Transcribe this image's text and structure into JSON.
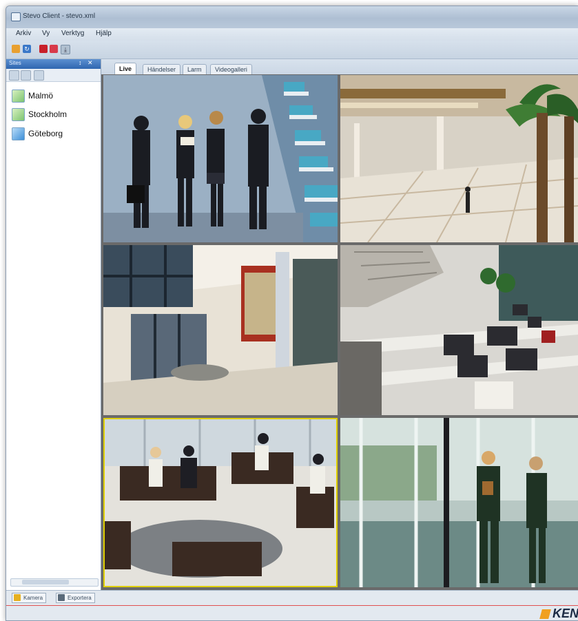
{
  "window": {
    "title": "Stevo Client - stevo.xml"
  },
  "menu": [
    "Arkiv",
    "Vy",
    "Verktyg",
    "Hjälp"
  ],
  "sidebar": {
    "title": "Sites",
    "pin": "↕",
    "close": "✕",
    "sites": [
      {
        "label": "Malmö"
      },
      {
        "label": "Stockholm"
      },
      {
        "label": "Göteborg"
      }
    ]
  },
  "tabs": [
    {
      "label": "Live",
      "active": true
    },
    {
      "label": "Händelser",
      "active": false
    },
    {
      "label": "Larm",
      "active": false
    },
    {
      "label": "Videogalleri",
      "active": false
    }
  ],
  "bottom_tabs": [
    "Kamera",
    "Exportera"
  ],
  "logo": {
    "text": "KEN"
  },
  "cameras": [
    {
      "scene": "businesspeople-stairs",
      "selected": false
    },
    {
      "scene": "mall-atrium-palms",
      "selected": false
    },
    {
      "scene": "office-lobby-entrance",
      "selected": false
    },
    {
      "scene": "stairs-lobby-seating",
      "selected": false
    },
    {
      "scene": "lounge-sofas-meeting",
      "selected": true
    },
    {
      "scene": "glass-doors-entrance",
      "selected": false
    }
  ],
  "colors": {
    "panel_header": "#2f66b0",
    "selected_camera_border": "#e0d000",
    "accent_line": "#e05050",
    "logo_accent": "#f0a020"
  }
}
